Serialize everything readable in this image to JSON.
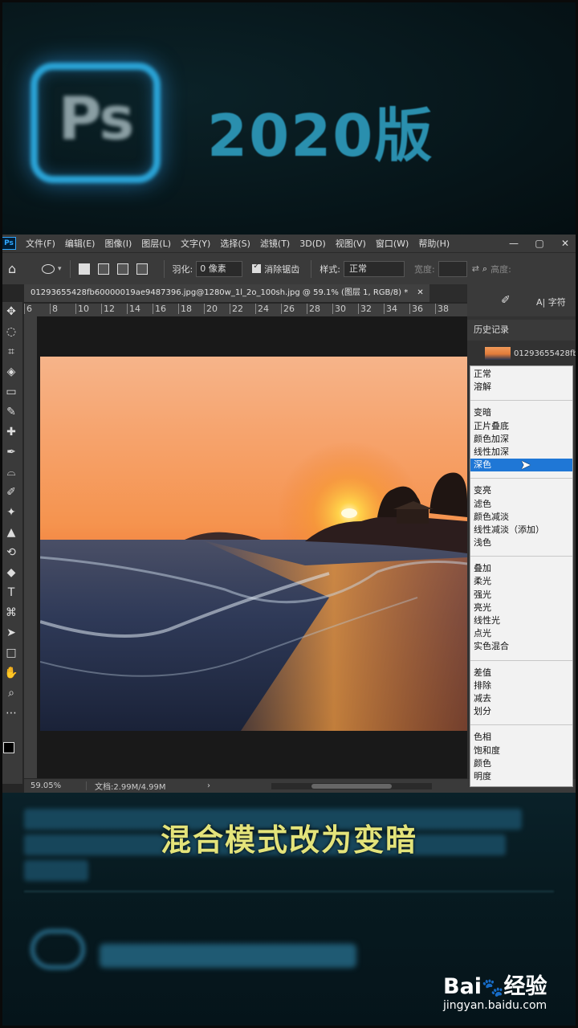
{
  "banner": {
    "logo_text": "Ps",
    "title": "2020版"
  },
  "menubar": {
    "app_icon": "Ps",
    "items": [
      "文件(F)",
      "编辑(E)",
      "图像(I)",
      "图层(L)",
      "文字(Y)",
      "选择(S)",
      "滤镜(T)",
      "3D(D)",
      "视图(V)",
      "窗口(W)",
      "帮助(H)"
    ],
    "window_controls": [
      "—",
      "▢",
      "✕"
    ]
  },
  "options_bar": {
    "feather_label": "羽化:",
    "feather_value": "0 像素",
    "antialias_label": "消除锯齿",
    "style_label": "样式:",
    "style_value": "正常",
    "width_label": "宽度:",
    "height_label": "高度:"
  },
  "document_tab": {
    "title": "01293655428fb60000019ae9487396.jpg@1280w_1l_2o_100sh.jpg @ 59.1% (图层 1, RGB/8) *",
    "close": "✕"
  },
  "ruler": {
    "top_ticks": [
      "6",
      "8",
      "10",
      "12",
      "14",
      "16",
      "18",
      "20",
      "22",
      "24",
      "26",
      "28",
      "30",
      "32",
      "34",
      "36",
      "38"
    ],
    "left_ticks": [
      "2",
      "0",
      "2",
      "4",
      "6",
      "8",
      "1 0",
      "1 2",
      "1 4",
      "1 6",
      "1 8",
      "2 0",
      "2 2",
      "2 4",
      "2 6",
      "2 8",
      "3 0",
      "3 2"
    ]
  },
  "tools": [
    "move-tool",
    "marquee-tool",
    "crop-tool",
    "paint-bucket-tool",
    "gradient-tool",
    "eyedropper-tool",
    "healing-tool",
    "pen-tool",
    "lasso-tool",
    "brush-tool",
    "clone-tool",
    "stamp-tool",
    "history-brush-tool",
    "eraser-tool",
    "type-tool",
    "path-tool",
    "select-tool",
    "rect-tool",
    "hand-tool",
    "zoom-tool",
    "more-tool"
  ],
  "tool_glyphs": [
    "✥",
    "◌",
    "⌗",
    "◈",
    "▭",
    "✎",
    "✚",
    "✒",
    "⌓",
    "✐",
    "✦",
    "▲",
    "⟲",
    "◆",
    "T",
    "⌘",
    "➤",
    "□",
    "✋",
    "⌕",
    "⋯"
  ],
  "colors": {
    "foreground": "#000000",
    "background": "#31a8ff",
    "menu_selected": "#1f77d6",
    "subtitle": "#e3e37a"
  },
  "status_bar": {
    "zoom": "59.05%",
    "doc_size": "文档:2.99M/4.99M",
    "arrow": "›"
  },
  "right_dock": {
    "character_label": "字符",
    "history_title": "历史记录",
    "history_item": "01293655428fb"
  },
  "blend_menu": {
    "groups": [
      [
        "正常",
        "溶解"
      ],
      [
        "变暗",
        "正片叠底",
        "颜色加深",
        "线性加深",
        "深色"
      ],
      [
        "变亮",
        "滤色",
        "颜色减淡",
        "线性减淡（添加）",
        "浅色"
      ],
      [
        "叠加",
        "柔光",
        "强光",
        "亮光",
        "线性光",
        "点光",
        "实色混合"
      ],
      [
        "差值",
        "排除",
        "减去",
        "划分"
      ],
      [
        "色相",
        "饱和度",
        "颜色",
        "明度"
      ]
    ],
    "selected": "深色"
  },
  "subtitle": "混合模式改为变暗",
  "watermark": {
    "brand_left": "Bai",
    "brand_paw": "🐾",
    "brand_right": "经验",
    "url": "jingyan.baidu.com"
  }
}
